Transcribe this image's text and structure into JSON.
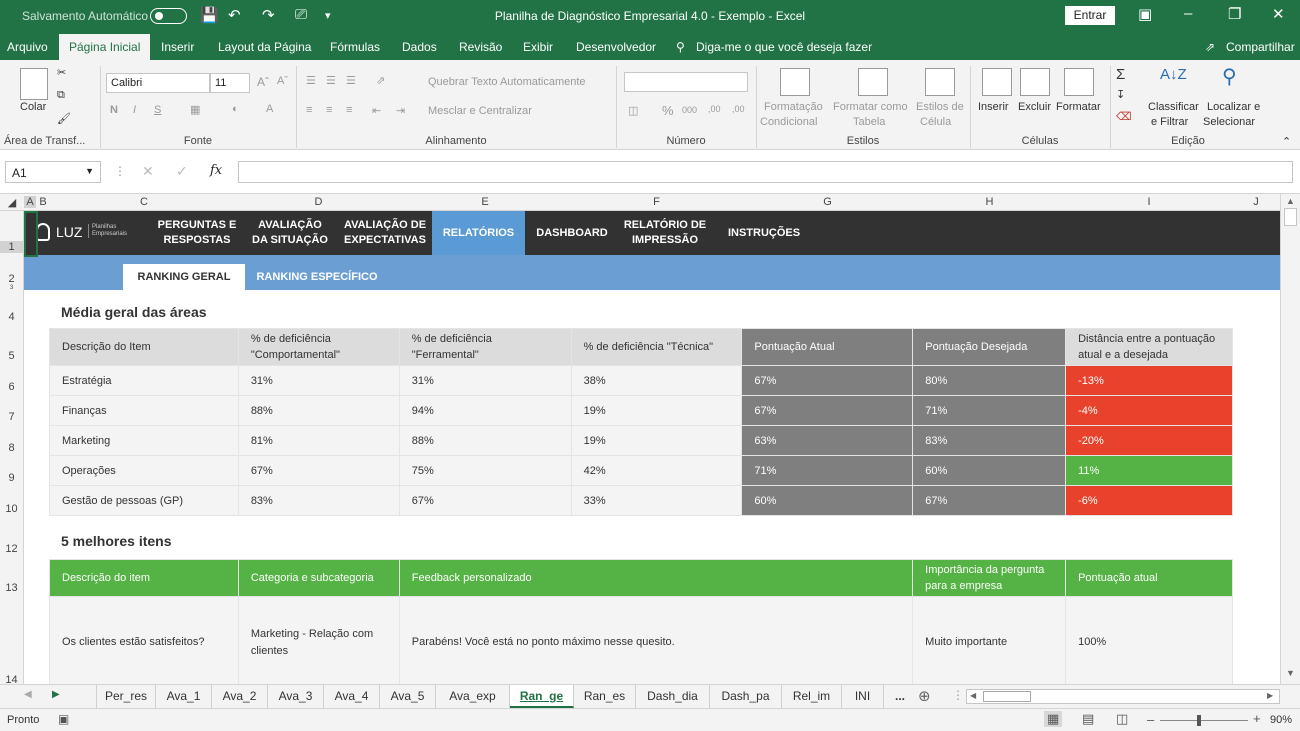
{
  "titlebar": {
    "autosave": "Salvamento Automático",
    "title": "Planilha de Diagnóstico Empresarial 4.0 - Exemplo  -  Excel",
    "signin": "Entrar"
  },
  "menu": {
    "tabs": [
      "Arquivo",
      "Página Inicial",
      "Inserir",
      "Layout da Página",
      "Fórmulas",
      "Dados",
      "Revisão",
      "Exibir",
      "Desenvolvedor"
    ],
    "tellme": "Diga-me o que você deseja fazer",
    "share": "Compartilhar"
  },
  "ribbon": {
    "paste": "Colar",
    "clipboard": "Área de Transf...",
    "font_name": "Calibri",
    "font_size": "11",
    "font_group": "Fonte",
    "wrap_text": "Quebrar Texto Automaticamente",
    "merge_center": "Mesclar e Centralizar",
    "alignment_group": "Alinhamento",
    "number_group": "Número",
    "cond_format_1": "Formatação",
    "cond_format_2": "Condicional",
    "format_table_1": "Formatar como",
    "format_table_2": "Tabela",
    "cell_styles_1": "Estilos de",
    "cell_styles_2": "Célula",
    "styles_group": "Estilos",
    "insert": "Inserir",
    "delete": "Excluir",
    "format": "Formatar",
    "cells_group": "Células",
    "sort_1": "Classificar",
    "sort_2": "e Filtrar",
    "find_1": "Localizar e",
    "find_2": "Selecionar",
    "editing_group": "Edição"
  },
  "formula": {
    "cell": "A1",
    "fx": "fx"
  },
  "columns": [
    "A",
    "B",
    "C",
    "D",
    "E",
    "F",
    "G",
    "H",
    "I",
    "J"
  ],
  "rows": [
    "1",
    "2",
    "3",
    "4",
    "5",
    "6",
    "7",
    "8",
    "9",
    "10",
    "12",
    "13",
    "14"
  ],
  "nav": {
    "logo": "LUZ",
    "logo_sub": "Planilhas Empresariais",
    "items": [
      {
        "l1": "PERGUNTAS E",
        "l2": "RESPOSTAS"
      },
      {
        "l1": "AVALIAÇÃO",
        "l2": "DA SITUAÇÃO"
      },
      {
        "l1": "AVALIAÇÃO DE",
        "l2": "EXPECTATIVAS"
      },
      {
        "l1": "RELATÓRIOS",
        "l2": ""
      },
      {
        "l1": "DASHBOARD",
        "l2": ""
      },
      {
        "l1": "RELATÓRIO DE",
        "l2": "IMPRESSÃO"
      },
      {
        "l1": "INSTRUÇÕES",
        "l2": ""
      }
    ]
  },
  "subnav": {
    "general": "RANKING GERAL",
    "specific": "RANKING ESPECÍFICO"
  },
  "areas": {
    "heading": "Média geral das áreas",
    "headers": [
      "Descrição do Item",
      "% de deficiência \"Comportamental\"",
      "% de deficiência \"Ferramental\"",
      "% de deficiência \"Técnica\"",
      "Pontuação Atual",
      "Pontuação Desejada",
      "Distância entre a pontuação atual e a desejada"
    ],
    "rows": [
      [
        "Estratégia",
        "31%",
        "31%",
        "38%",
        "67%",
        "80%",
        "-13%"
      ],
      [
        "Finanças",
        "88%",
        "94%",
        "19%",
        "67%",
        "71%",
        "-4%"
      ],
      [
        "Marketing",
        "81%",
        "88%",
        "19%",
        "63%",
        "83%",
        "-20%"
      ],
      [
        "Operações",
        "67%",
        "75%",
        "42%",
        "71%",
        "60%",
        "11%"
      ],
      [
        "Gestão de pessoas (GP)",
        "83%",
        "67%",
        "33%",
        "60%",
        "67%",
        "-6%"
      ]
    ],
    "status": [
      "red",
      "red",
      "red",
      "green",
      "red"
    ]
  },
  "best": {
    "heading": "5 melhores itens",
    "headers": [
      "Descrição do item",
      "Categoria e subcategoria",
      "Feedback personalizado",
      "Importância da pergunta para a empresa",
      "Pontuação atual"
    ],
    "row": [
      "Os clientes estão satisfeitos?",
      "Marketing - Relação com clientes",
      "Parabéns! Você está no ponto máximo nesse quesito.",
      "Muito importante",
      "100%"
    ]
  },
  "sheet_tabs": [
    "Per_res",
    "Ava_1",
    "Ava_2",
    "Ava_3",
    "Ava_4",
    "Ava_5",
    "Ava_exp",
    "Ran_ge",
    "Ran_es",
    "Dash_dia",
    "Dash_pa",
    "Rel_im",
    "INI",
    "..."
  ],
  "status": {
    "ready": "Pronto",
    "zoom": "90%"
  },
  "colors": {
    "excel_green": "#217346",
    "nav_dark": "#323232",
    "nav_active": "#5b9bd5",
    "red": "#e8422d",
    "green": "#55b244"
  }
}
